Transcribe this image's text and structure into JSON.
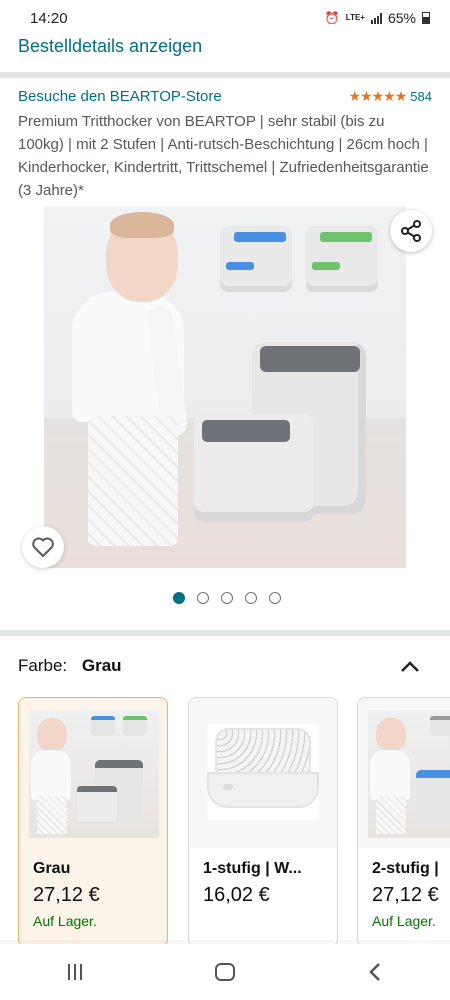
{
  "status_bar": {
    "time": "14:20",
    "network_label": "LTE+",
    "battery_percent": "65%"
  },
  "header": {
    "back_link": "Bestelldetails anzeigen"
  },
  "product": {
    "store_link": "Besuche den BEARTOP-Store",
    "stars_display": "★★★★★",
    "rating_count": "584",
    "title": "Premium Tritthocker von BEARTOP | sehr stabil (bis zu 100kg) | mit 2 Stufen | Anti-rutsch-Beschichtung | 26cm hoch | Kinderhocker, Kindertritt, Trittschemel | Zufriedenheitsgarantie (3 Jahre)*",
    "image_dot_count": 5,
    "active_image_index": 0,
    "accent_blue": "#4a90e2",
    "accent_green": "#6cc36c"
  },
  "color_selector": {
    "label": "Farbe:",
    "value": "Grau"
  },
  "variants": [
    {
      "name": "Grau",
      "price": "27,12 €",
      "stock": "Auf Lager."
    },
    {
      "name": "1-stufig | W...",
      "price": "16,02 €",
      "stock": ""
    },
    {
      "name": "2-stufig |",
      "price": "27,12 €",
      "stock": "Auf Lager."
    }
  ],
  "colors": {
    "link": "#007185",
    "stock_green": "#007600",
    "star_orange": "#de7921",
    "selected_border": "#e8b26b"
  }
}
